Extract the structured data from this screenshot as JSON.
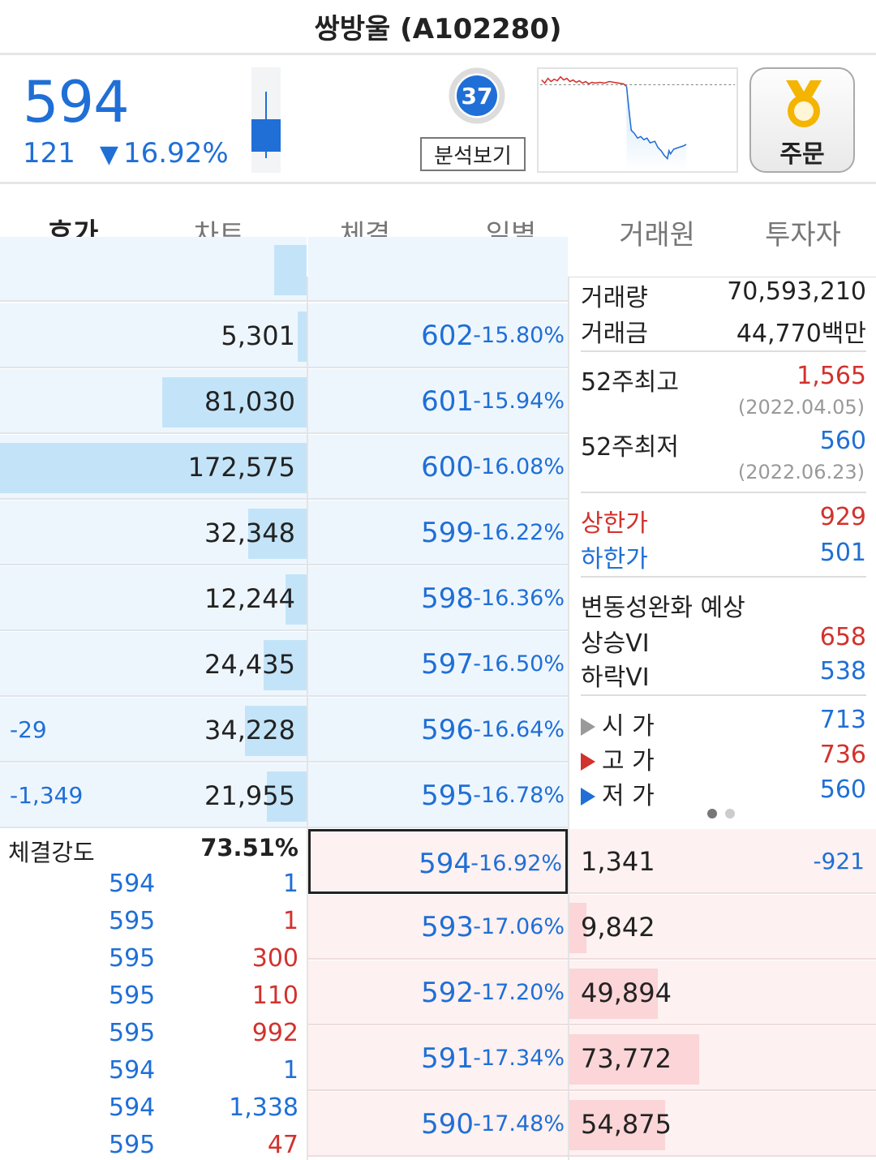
{
  "title": "쌍방울 (A102280)",
  "header": {
    "price": "594",
    "change": "121",
    "change_arrow": "▼",
    "change_pct": "16.92%",
    "score": "37",
    "analysis_label": "분석보기",
    "order_label": "주문"
  },
  "tabs": [
    "호가",
    "차트",
    "체결",
    "일별",
    "거래원",
    "투자자"
  ],
  "asks": [
    {
      "qty": "5,301",
      "change": "",
      "price": "602",
      "pct": "-15.80%",
      "ratio": 0.03
    },
    {
      "qty": "81,030",
      "change": "",
      "price": "601",
      "pct": "-15.94%",
      "ratio": 0.47
    },
    {
      "qty": "172,575",
      "change": "",
      "price": "600",
      "pct": "-16.08%",
      "ratio": 1.0
    },
    {
      "qty": "32,348",
      "change": "",
      "price": "599",
      "pct": "-16.22%",
      "ratio": 0.19
    },
    {
      "qty": "12,244",
      "change": "",
      "price": "598",
      "pct": "-16.36%",
      "ratio": 0.07
    },
    {
      "qty": "24,435",
      "change": "",
      "price": "597",
      "pct": "-16.50%",
      "ratio": 0.14
    },
    {
      "qty": "34,228",
      "change": "-29",
      "price": "596",
      "pct": "-16.64%",
      "ratio": 0.2
    },
    {
      "qty": "21,955",
      "change": "-1,349",
      "price": "595",
      "pct": "-16.78%",
      "ratio": 0.13
    }
  ],
  "bids": [
    {
      "price": "594",
      "pct": "-16.92%",
      "qty": "1,341",
      "change": "-921",
      "ratio": 0.0
    },
    {
      "price": "593",
      "pct": "-17.06%",
      "qty": "9,842",
      "change": "",
      "ratio": 0.13
    },
    {
      "price": "592",
      "pct": "-17.20%",
      "qty": "49,894",
      "change": "",
      "ratio": 0.68
    },
    {
      "price": "591",
      "pct": "-17.34%",
      "qty": "73,772",
      "change": "",
      "ratio": 1.0
    },
    {
      "price": "590",
      "pct": "-17.48%",
      "qty": "54,875",
      "change": "",
      "ratio": 0.74
    }
  ],
  "info": {
    "volume_label": "거래량",
    "volume": "70,593,210",
    "amount_label": "거래금",
    "amount": "44,770백만",
    "high52_label": "52주최고",
    "high52": "1,565",
    "high52_date": "(2022.04.05)",
    "low52_label": "52주최저",
    "low52": "560",
    "low52_date": "(2022.06.23)",
    "upper_label": "상한가",
    "upper": "929",
    "lower_label": "하한가",
    "lower": "501",
    "vi_title": "변동성완화 예상",
    "vi_up_label": "상승VI",
    "vi_up": "658",
    "vi_down_label": "하락VI",
    "vi_down": "538",
    "open_label": "시 가",
    "open": "713",
    "high_label": "고 가",
    "high": "736",
    "low_label": "저 가",
    "low": "560"
  },
  "trades": {
    "strength_label": "체결강도",
    "strength_value": "73.51%",
    "list": [
      {
        "price": "594",
        "vol": "1",
        "dir": "blue"
      },
      {
        "price": "595",
        "vol": "1",
        "dir": "red"
      },
      {
        "price": "595",
        "vol": "300",
        "dir": "red"
      },
      {
        "price": "595",
        "vol": "110",
        "dir": "red"
      },
      {
        "price": "595",
        "vol": "992",
        "dir": "red"
      },
      {
        "price": "594",
        "vol": "1",
        "dir": "blue"
      },
      {
        "price": "594",
        "vol": "1,338",
        "dir": "blue"
      },
      {
        "price": "595",
        "vol": "47",
        "dir": "red"
      }
    ]
  },
  "colors": {
    "up": "#d2322d",
    "down": "#1f6fd6",
    "ask_bg": "#eef6fd",
    "ask_bar": "#c3e4f8",
    "bid_bg": "#fdf1f1",
    "bid_bar": "#fbd5d7"
  }
}
